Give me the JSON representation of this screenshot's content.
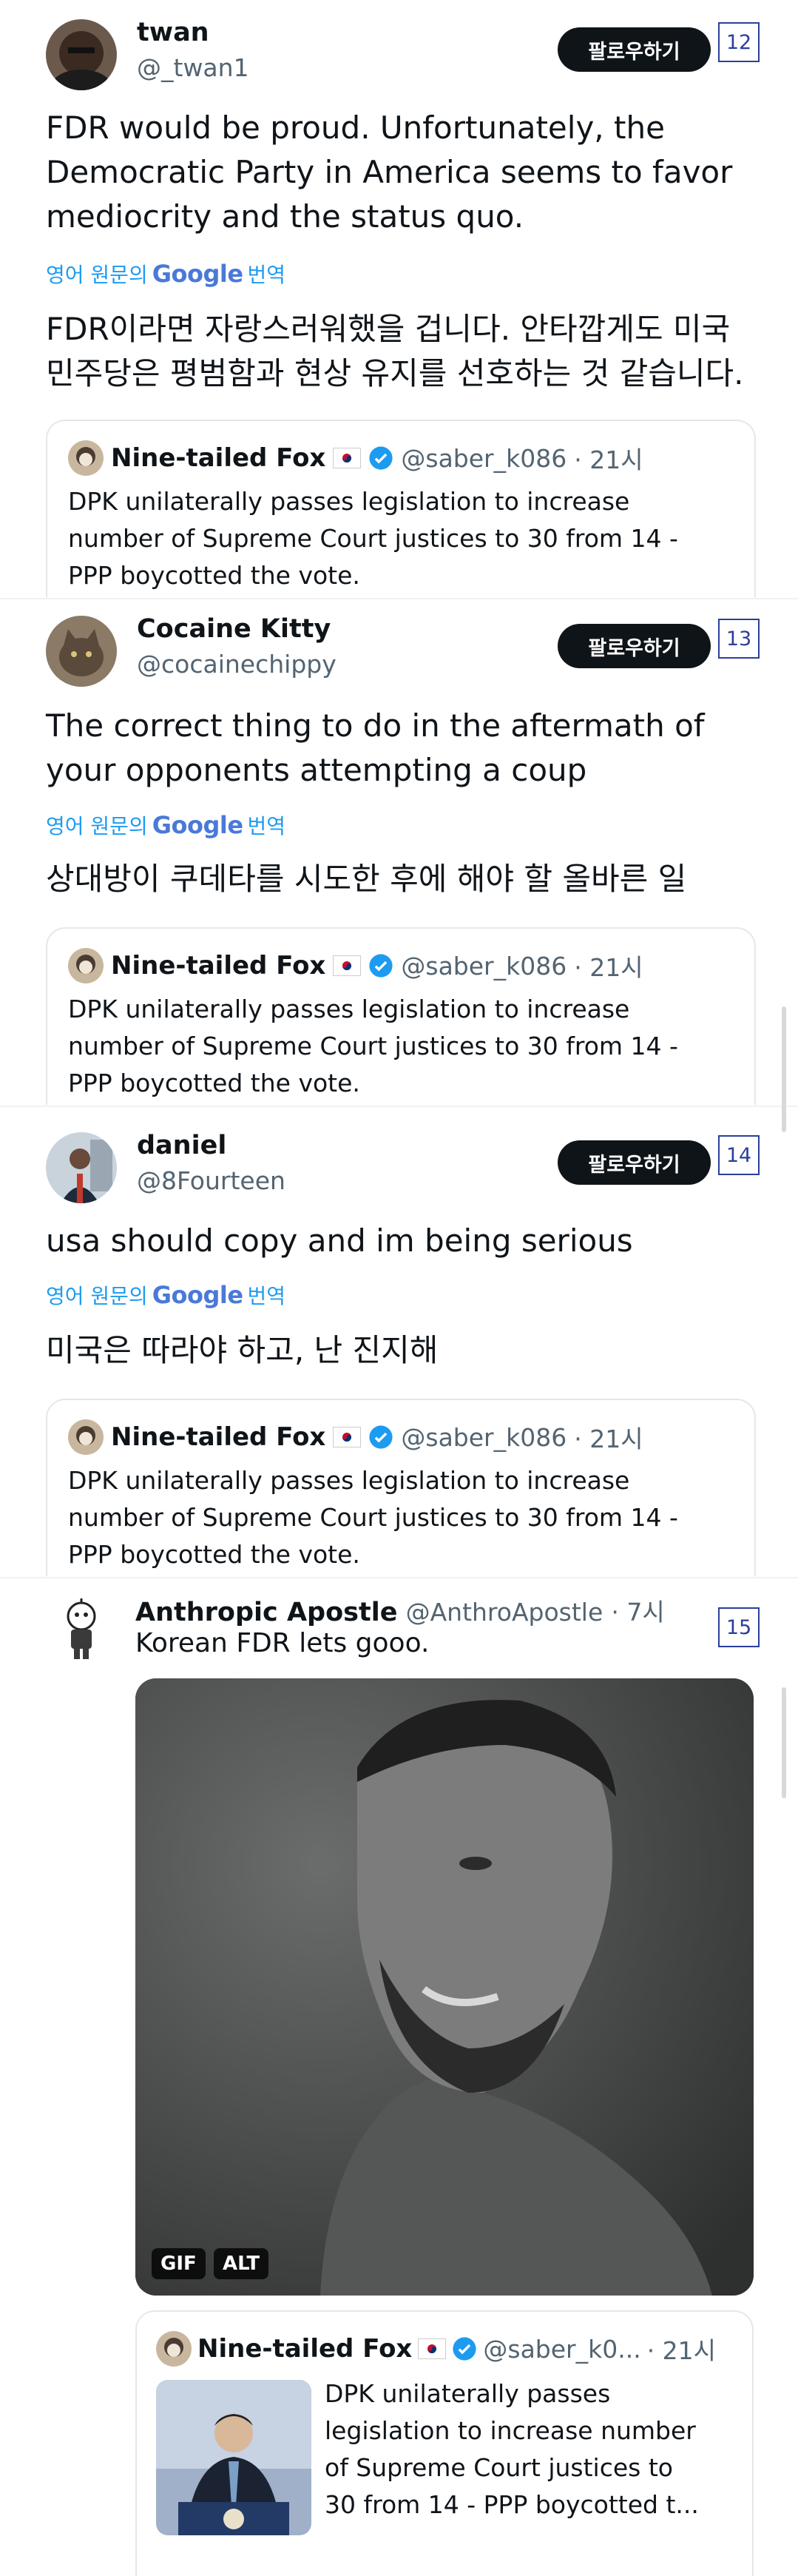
{
  "common": {
    "follow_label": "팔로우하기",
    "translate_prefix": "영어 원문의",
    "translate_google": "Google",
    "translate_suffix": "번역"
  },
  "quoted": {
    "name": "Nine-tailed Fox",
    "handle": "@saber_k086",
    "handle_truncated": "@saber_k0...",
    "time": "· 21시",
    "text_lines": [
      "DPK unilaterally passes legislation to increase",
      "number of Supreme Court justices to 30 from 14 -",
      "PPP boycotted the vote."
    ],
    "short_lines": [
      "DPK unilaterally passes",
      "legislation to increase number",
      "of Supreme Court justices to",
      "30 from 14 - PPP boycotted t..."
    ]
  },
  "tweets": [
    {
      "number": "12",
      "name": "twan",
      "handle": "@_twan1",
      "text_lines": [
        "FDR would be proud. Unfortunately, the",
        "Democratic Party in America seems to favor",
        "mediocrity and the status quo."
      ],
      "translated_lines": [
        "FDR이라면 자랑스러워했을 겁니다. 안타깝게도 미국",
        "민주당은 평범함과 현상 유지를 선호하는 것 같습니다."
      ]
    },
    {
      "number": "13",
      "name": "Cocaine Kitty",
      "handle": "@cocainechippy",
      "text_lines": [
        "The correct thing to do in the aftermath of",
        "your opponents attempting a coup"
      ],
      "translated_lines": [
        "상대방이 쿠데타를 시도한 후에 해야 할 올바른 일"
      ]
    },
    {
      "number": "14",
      "name": "daniel",
      "handle": "@8Fourteen",
      "text_lines": [
        "usa should copy and im being serious"
      ],
      "translated_lines": [
        "미국은 따라야 하고, 난 진지해"
      ]
    },
    {
      "number": "15",
      "name": "Anthropic Apostle",
      "handle": "@AnthroApostle",
      "time": "· 7시",
      "text_lines": [
        "Korean FDR lets gooo."
      ],
      "media_badges": [
        "GIF",
        "ALT"
      ]
    }
  ]
}
